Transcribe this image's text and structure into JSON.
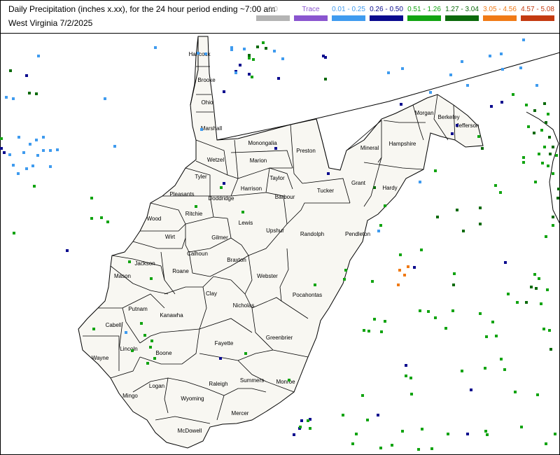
{
  "header": {
    "title_line1": "Daily Precipitation (inches  x.xx),  for the 24 hour period ending ~7:00 am",
    "title_line2": "West Virginia 7/2/2025"
  },
  "legend": [
    {
      "label": "0.0",
      "color": "#b4b4b4",
      "text_color": "#b4b4b4"
    },
    {
      "label": "Trace",
      "color": "#8a55cf",
      "text_color": "#8a55cf"
    },
    {
      "label": "0.01 - 0.25",
      "color": "#3f9bef",
      "text_color": "#3f9bef"
    },
    {
      "label": "0.26 - 0.50",
      "color": "#0a0a8e",
      "text_color": "#0a0a8e"
    },
    {
      "label": "0.51 - 1.26",
      "color": "#12a412",
      "text_color": "#12a412"
    },
    {
      "label": "1.27 - 3.04",
      "color": "#0b6a0b",
      "text_color": "#0b6a0b"
    },
    {
      "label": "3.05 - 4.56",
      "color": "#f07a16",
      "text_color": "#f07a16"
    },
    {
      "label": "4.57 - 5.08",
      "color": "#c43a10",
      "text_color": "#c43a10"
    }
  ],
  "counties": [
    "Hancock",
    "Brooke",
    "Ohio",
    "Marshall",
    "Wetzel",
    "Monongalia",
    "Preston",
    "Mineral",
    "Hampshire",
    "Morgan",
    "Berkeley",
    "Jefferson",
    "Tyler",
    "Marion",
    "Taylor",
    "Pleasants",
    "Doddridge",
    "Harrison",
    "Barbour",
    "Tucker",
    "Grant",
    "Hardy",
    "Wood",
    "Ritchie",
    "Lewis",
    "Upshur",
    "Randolph",
    "Pendleton",
    "Wirt",
    "Calhoun",
    "Gilmer",
    "Jackson",
    "Roane",
    "Braxton",
    "Webster",
    "Mason",
    "Clay",
    "Pocahontas",
    "Putnam",
    "Nicholas",
    "Kanawha",
    "Cabell",
    "Greenbrier",
    "Lincoln",
    "Fayette",
    "Boone",
    "Wayne",
    "Raleigh",
    "Summers",
    "Monroe",
    "Logan",
    "Mingo",
    "Wyoming",
    "Mercer",
    "McDowell"
  ],
  "station_categories": [
    "0.01 - 0.25",
    "0.26 - 0.50",
    "0.51 - 1.26",
    "1.27 - 3.04",
    "3.05 - 4.56"
  ]
}
